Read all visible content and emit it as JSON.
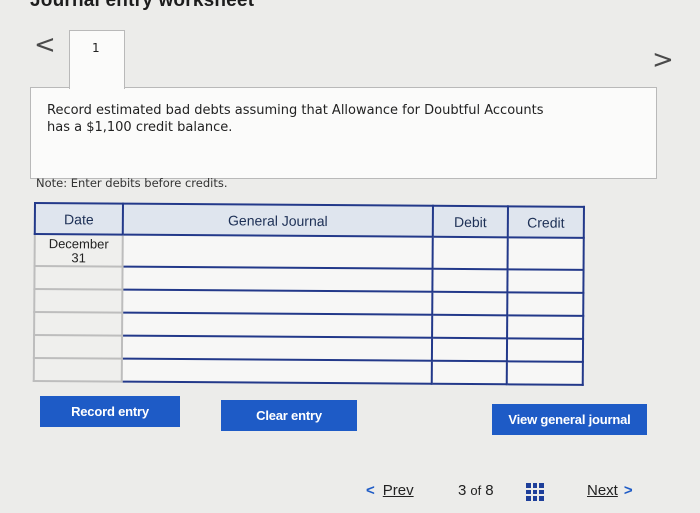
{
  "header": {
    "title": "Journal entry worksheet"
  },
  "nav": {
    "prev_icon": "chevron-left-icon",
    "next_icon": "chevron-right-icon",
    "left_glyph": "<",
    "right_glyph": ">"
  },
  "tabs": [
    {
      "label": "1"
    }
  ],
  "prompt": {
    "line1": "Record estimated bad debts assuming that Allowance for Doubtful Accounts",
    "line2": "has a $1,100 credit balance."
  },
  "note": "Note: Enter debits before credits.",
  "journal": {
    "headers": {
      "date": "Date",
      "account": "General Journal",
      "debit": "Debit",
      "credit": "Credit"
    },
    "first_date": {
      "month": "December",
      "day": "31"
    },
    "row_count": 6
  },
  "buttons": {
    "record": "Record entry",
    "clear": "Clear entry",
    "view": "View general journal"
  },
  "pagination": {
    "prev_label": "Prev",
    "current": "3",
    "of_label": "of",
    "total": "8",
    "next_label": "Next"
  },
  "colors": {
    "accent": "#1e5bc6",
    "table_border": "#23398a"
  }
}
